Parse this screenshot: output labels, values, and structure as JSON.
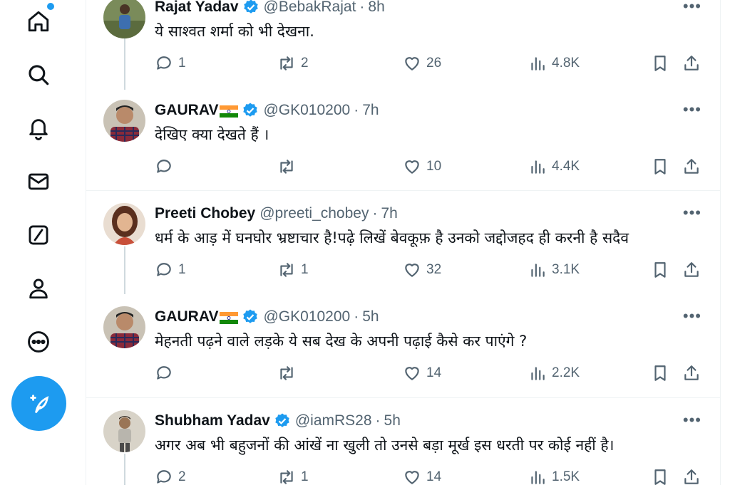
{
  "nav": {
    "items": [
      {
        "name": "home-icon"
      },
      {
        "name": "search-icon"
      },
      {
        "name": "notifications-icon"
      },
      {
        "name": "messages-icon"
      },
      {
        "name": "grok-icon"
      },
      {
        "name": "profile-icon"
      },
      {
        "name": "more-icon"
      }
    ],
    "compose_icon": "compose-post-icon",
    "accent": "#1d9bf0"
  },
  "posts": [
    {
      "name": "Rajat Yadav",
      "verified": true,
      "handle": "@BebakRajat",
      "time": "8h",
      "text": "ये साश्वत शर्मा को भी देखना.",
      "replies": "1",
      "reposts": "2",
      "likes": "26",
      "views": "4.8K",
      "flag": false
    },
    {
      "name": "GAURAV",
      "verified": true,
      "handle": "@GK010200",
      "time": "7h",
      "text": "देखिए क्या देखते हैं ।",
      "replies": "",
      "reposts": "",
      "likes": "10",
      "views": "4.4K",
      "flag": true
    },
    {
      "name": "Preeti Chobey",
      "verified": false,
      "handle": "@preeti_chobey",
      "time": "7h",
      "text": "धर्म के आड़ में घनघोर भ्रष्टाचार है!पढ़े लिखें बेवकूफ़ है उनको जद्दोजहद ही करनी है सदैव",
      "replies": "1",
      "reposts": "1",
      "likes": "32",
      "views": "3.1K",
      "flag": false
    },
    {
      "name": "GAURAV",
      "verified": true,
      "handle": "@GK010200",
      "time": "5h",
      "text": "मेहनती पढ़ने वाले लड़के ये सब देख के अपनी पढ़ाई कैसे कर पाएंगे ?",
      "replies": "",
      "reposts": "",
      "likes": "14",
      "views": "2.2K",
      "flag": true
    },
    {
      "name": "Shubham Yadav",
      "verified": true,
      "handle": "@iamRS28",
      "time": "5h",
      "text": "अगर अब भी बहुजनों की आंखें ना खुली तो उनसे बड़ा मूर्ख इस धरती पर कोई नहीं है।",
      "replies": "2",
      "reposts": "1",
      "likes": "14",
      "views": "1.5K",
      "flag": false
    }
  ],
  "more_label": "•••",
  "sep": "·"
}
